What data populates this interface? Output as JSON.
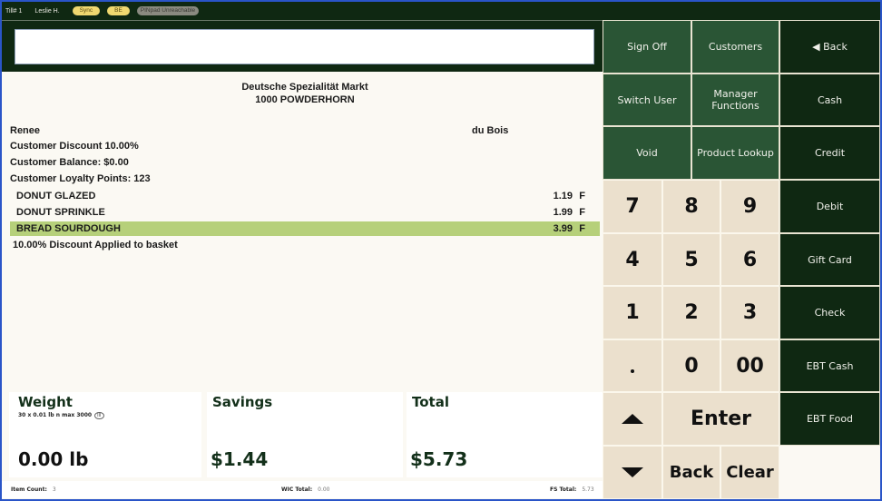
{
  "status_bar": {
    "till": "Till# 1",
    "user": "Leslie H.",
    "badges": [
      {
        "label": "Sync",
        "color": "#f0d870"
      },
      {
        "label": "BE",
        "color": "#f0d870"
      },
      {
        "label": "PINpad Unreachable",
        "color": "#8a8a80"
      }
    ]
  },
  "scan_input": {
    "value": "",
    "placeholder": ""
  },
  "receipt": {
    "store_name": "Deutsche Spezialität Markt",
    "store_address": "1000 POWDERHORN",
    "customer_first": "Renee",
    "customer_last": "du Bois",
    "customer_lines": [
      "Customer Discount 10.00%",
      "Customer Balance: $0.00",
      "Customer Loyalty Points: 123"
    ],
    "items": [
      {
        "name": "DONUT GLAZED",
        "price": "1.19",
        "flag": "F",
        "selected": false
      },
      {
        "name": "DONUT SPRINKLE",
        "price": "1.99",
        "flag": "F",
        "selected": false
      },
      {
        "name": "BREAD SOURDOUGH",
        "price": "3.99",
        "flag": "F",
        "selected": true
      }
    ],
    "note": "10.00% Discount Applied to basket",
    "highlight_color": "#b6d07a"
  },
  "totals": {
    "weight": {
      "label": "Weight",
      "sub": "30 x 0.01 lb n max 3000",
      "badge": "III",
      "value": "0.00 lb"
    },
    "savings": {
      "label": "Savings",
      "value": "$1.44"
    },
    "total": {
      "label": "Total",
      "value": "$5.73"
    }
  },
  "footer": {
    "item_count_label": "Item Count:",
    "item_count": "3",
    "wic_label": "WIC Total:",
    "wic_value": "0.00",
    "fs_label": "FS Total:",
    "fs_value": "5.73"
  },
  "function_buttons": {
    "sign_off": "Sign Off",
    "customers": "Customers",
    "back_nav": "◀ Back",
    "switch_user": "Switch User",
    "manager_functions": "Manager Functions",
    "void": "Void",
    "product_lookup": "Product Lookup"
  },
  "payment_buttons": [
    "Cash",
    "Credit",
    "Debit",
    "Gift Card",
    "Check",
    "EBT Cash",
    "EBT Food"
  ],
  "keypad": {
    "digits": [
      "7",
      "8",
      "9",
      "4",
      "5",
      "6",
      "1",
      "2",
      "3"
    ],
    "zero": "0",
    "double_zero": "00",
    "enter": "Enter",
    "back": "Back",
    "clear": "Clear"
  },
  "colors": {
    "dark_green": "#0f2812",
    "function_green": "#2a5535",
    "keypad_beige": "#ebe0cd",
    "frame_blue": "#2a55c8"
  }
}
